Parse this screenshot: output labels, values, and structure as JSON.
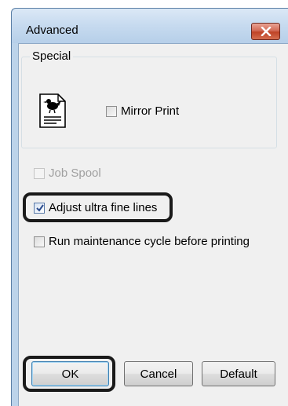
{
  "window": {
    "title": "Advanced",
    "close_icon": "close-icon"
  },
  "special_group": {
    "label": "Special",
    "icon": "printer-mirror-icon",
    "mirror_print": {
      "label": "Mirror Print",
      "checked": false
    }
  },
  "options": {
    "job_spool": {
      "label": "Job Spool",
      "checked": false,
      "enabled": false
    },
    "adjust_ultra_fine_lines": {
      "label": "Adjust ultra fine lines",
      "checked": true,
      "enabled": true
    },
    "run_maintenance": {
      "label": "Run maintenance cycle before printing",
      "checked": false,
      "enabled": true
    }
  },
  "buttons": {
    "ok": "OK",
    "cancel": "Cancel",
    "default": "Default"
  },
  "colors": {
    "titlebar": "#c6daef",
    "close_button": "#c04327",
    "highlight_outline": "#1a1a1a"
  }
}
